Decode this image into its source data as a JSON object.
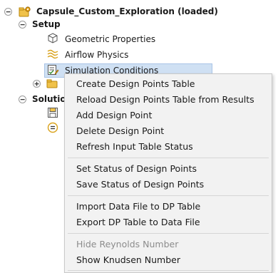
{
  "tree": {
    "root": {
      "label": "Capsule_Custom_Exploration (loaded)",
      "toggle": "−",
      "icon": "folder-gear-icon"
    },
    "setup": {
      "label": "Setup",
      "toggle": "−"
    },
    "setup_items": [
      {
        "label": "Geometric Properties",
        "icon": "cube-icon"
      },
      {
        "label": "Airflow Physics",
        "icon": "airflow-waves-icon"
      },
      {
        "label": "Simulation Conditions",
        "icon": "checklist-edit-icon",
        "selected": true
      }
    ],
    "collapsed_node": {
      "toggle": "+",
      "icon": "folder-icon"
    },
    "solution": {
      "label": "Solutio",
      "toggle": "−"
    },
    "solution_icons": [
      "save-icon",
      "equals-circle-icon"
    ]
  },
  "context_menu": {
    "groups": [
      [
        "Create Design Points Table",
        "Reload Design Points Table from Results",
        "Add Design Point",
        "Delete Design Point",
        "Refresh Input Table Status"
      ],
      [
        "Set Status of Design Points",
        "Save Status of Design Points"
      ],
      [
        "Import Data File to DP Table",
        "Export DP Table to Data File"
      ],
      [
        "Hide Reynolds Number",
        "Show Knudsen Number"
      ]
    ],
    "disabled_items": [
      "Hide Reynolds Number"
    ]
  },
  "colors": {
    "selection_bg": "#cfe0f3",
    "selection_border": "#a9c4e6",
    "menu_bg": "#f2f2f2",
    "disabled_text": "#8c8c8c",
    "icon_gold": "#d9a21b",
    "icon_blue": "#3a6fb5"
  }
}
